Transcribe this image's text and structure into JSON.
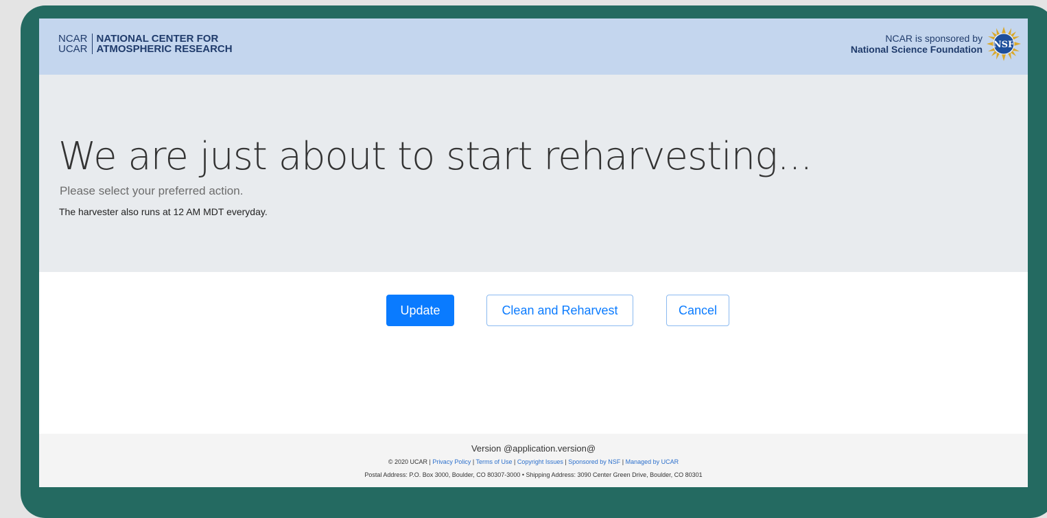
{
  "header": {
    "logo": {
      "abbr_line1": "NCAR",
      "abbr_line2": "UCAR",
      "name_line1": "NATIONAL CENTER FOR",
      "name_line2": "ATMOSPHERIC RESEARCH"
    },
    "sponsor": {
      "line1": "NCAR is sponsored by",
      "line2": "National Science Foundation",
      "icon": "nsf-logo",
      "logo_text": "NSF"
    }
  },
  "jumbotron": {
    "title": "We are just about to start reharvesting...",
    "lead": "Please select your preferred action.",
    "note": "The harvester also runs at 12 AM MDT everyday."
  },
  "actions": {
    "update_label": "Update",
    "clean_label": "Clean and Reharvest",
    "cancel_label": "Cancel"
  },
  "footer": {
    "version": "Version @application.version@",
    "copyright": "© 2020 UCAR",
    "links": [
      "Privacy Policy",
      "Terms of Use",
      "Copyright Issues",
      "Sponsored by NSF",
      "Managed by UCAR"
    ],
    "separator": " | ",
    "address": "Postal Address: P.O. Box 3000, Boulder, CO 80307-3000 • Shipping Address: 3090 Center Green Drive, Boulder, CO 80301"
  },
  "colors": {
    "frame": "#246a61",
    "header_bg": "#c4d6ee",
    "jumbotron_bg": "#e8ebee",
    "primary": "#0a7bff",
    "logo_text": "#1f3b6b"
  }
}
